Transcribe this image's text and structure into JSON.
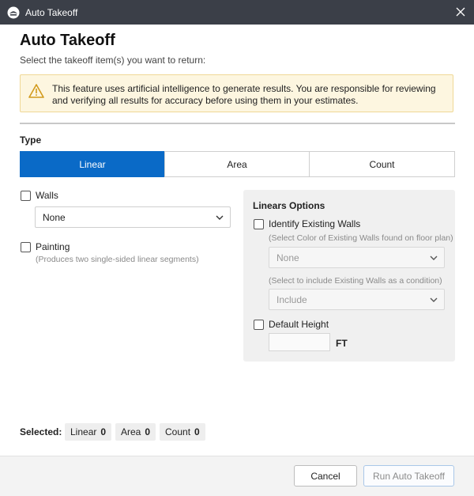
{
  "window": {
    "title": "Auto Takeoff",
    "close_icon": "close-icon",
    "app_icon": "app-logo-icon"
  },
  "header": {
    "title": "Auto Takeoff",
    "subtitle": "Select the takeoff item(s) you want to return:"
  },
  "warning": {
    "icon": "warning-icon",
    "text": "This feature uses artificial intelligence to generate results. You are responsible for reviewing and verifying all results for accuracy before using them in your estimates."
  },
  "type": {
    "label": "Type",
    "options": [
      "Linear",
      "Area",
      "Count"
    ],
    "selected": "Linear"
  },
  "left_options": {
    "walls": {
      "label": "Walls",
      "checked": false,
      "select_value": "None"
    },
    "painting": {
      "label": "Painting",
      "checked": false,
      "hint": "(Produces two single-sided linear segments)"
    }
  },
  "linears_options": {
    "title": "Linears Options",
    "identify_existing_walls": {
      "label": "Identify Existing Walls",
      "checked": false,
      "color_hint": "(Select Color of Existing Walls found on floor plan)",
      "color_value": "None",
      "condition_hint": "(Select to include Existing Walls as a condition)",
      "condition_value": "Include"
    },
    "default_height": {
      "label": "Default Height",
      "checked": false,
      "value": "",
      "unit": "FT"
    }
  },
  "selected": {
    "label": "Selected:",
    "chips": [
      {
        "name": "Linear",
        "count": "0"
      },
      {
        "name": "Area",
        "count": "0"
      },
      {
        "name": "Count",
        "count": "0"
      }
    ]
  },
  "footer": {
    "cancel_label": "Cancel",
    "run_label": "Run Auto Takeoff"
  },
  "colors": {
    "accent": "#0a6ac7",
    "titlebar": "#3b3f48",
    "warning_bg": "#fdf6e0",
    "warning_icon": "#d29a1c"
  }
}
